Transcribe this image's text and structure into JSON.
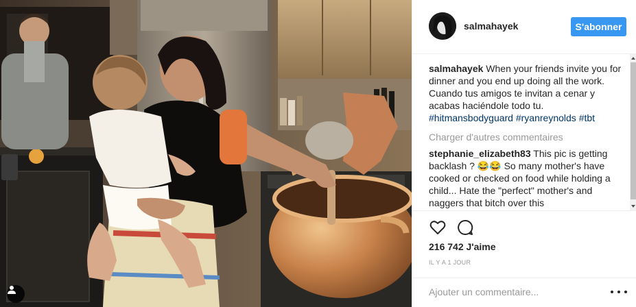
{
  "post": {
    "author": "salmahayek",
    "follow_label": "S'abonner",
    "caption": {
      "username": "salmahayek",
      "text": "When your friends invite you for dinner and you end up doing all the work. Cuando tus amigos te invitan a cenar y acabas haciéndole todo tu.",
      "hashtags": "#hitmansbodyguard #ryanreynolds #tbt"
    },
    "load_more_label": "Charger d'autres commentaires",
    "comments": [
      {
        "username": "stephanie_elizabeth83",
        "text": "This pic is getting backlash ? 😂😂 So many mother's have cooked or checked on food while holding a child... Hate the \"perfect\" mother's and naggers that bitch over this"
      }
    ],
    "likes": "216 742 J'aime",
    "timestamp": "IL Y A 1 JOUR",
    "add_comment_placeholder": "Ajouter un commentaire...",
    "icons": {
      "like": "heart-icon",
      "comment": "comment-bubble-icon",
      "user_tag": "user-tag-icon",
      "more": "more-options-icon"
    }
  },
  "colors": {
    "follow_button": "#3897f0",
    "hashtag": "#003569",
    "muted": "#999999"
  }
}
